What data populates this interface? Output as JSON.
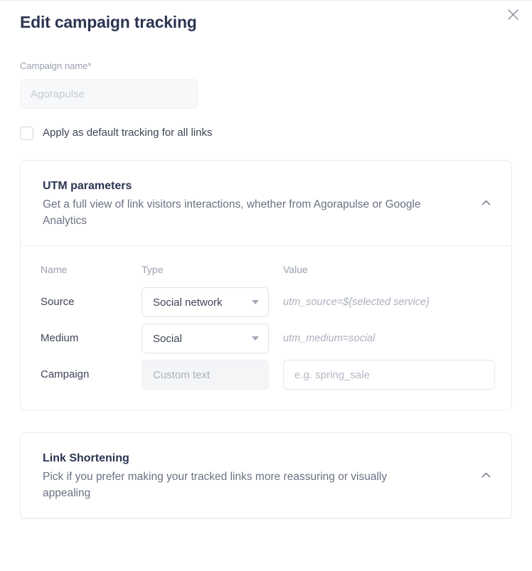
{
  "modal": {
    "title": "Edit campaign tracking",
    "close_icon": "close-icon"
  },
  "campaign_name": {
    "label": "Campaign name",
    "required_marker": "*",
    "placeholder": "Agorapulse",
    "value": ""
  },
  "default_tracking": {
    "label": "Apply as default tracking for all links",
    "checked": false
  },
  "utm_section": {
    "title": "UTM parameters",
    "subtitle": "Get a full view of link visitors interactions, whether from Agorapulse or Google Analytics",
    "collapse_icon": "chevron-up-icon",
    "columns": {
      "name": "Name",
      "type": "Type",
      "value": "Value"
    },
    "rows": [
      {
        "name": "Source",
        "type_value": "Social network",
        "type_disabled": false,
        "value_hint": "utm_source=${selected service}",
        "value_is_input": false
      },
      {
        "name": "Medium",
        "type_value": "Social",
        "type_disabled": false,
        "value_hint": "utm_medium=social",
        "value_is_input": false
      },
      {
        "name": "Campaign",
        "type_value": "Custom text",
        "type_disabled": true,
        "value_placeholder": "e.g. spring_sale",
        "value": "",
        "value_is_input": true
      }
    ]
  },
  "shortening_section": {
    "title": "Link Shortening",
    "subtitle": "Pick if you prefer making your tracked links more reassuring or visually appealing",
    "collapse_icon": "chevron-up-icon"
  },
  "colors": {
    "title_navy": "#2c3552",
    "muted_grey": "#9aa0ae",
    "body_text": "#3e4557",
    "card_border": "#eaecf0",
    "hint_italic": "#acb1bd"
  }
}
